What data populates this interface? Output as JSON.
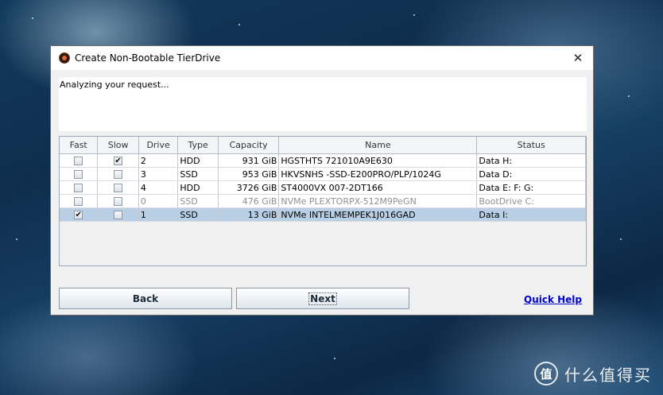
{
  "dialog": {
    "title": "Create Non-Bootable TierDrive",
    "close_glyph": "✕",
    "message": "Analyzing your request..."
  },
  "table": {
    "headers": [
      "Fast",
      "Slow",
      "Drive",
      "Type",
      "Capacity",
      "Name",
      "Status"
    ],
    "rows": [
      {
        "fast": false,
        "slow": true,
        "drive": "2",
        "type": "HDD",
        "capacity": "931 GiB",
        "name": "HGSTHTS 721010A9E630",
        "status": "Data H:",
        "disabled": false,
        "selected": false
      },
      {
        "fast": false,
        "slow": false,
        "drive": "3",
        "type": "SSD",
        "capacity": "953 GiB",
        "name": "HKVSNHS -SSD-E200PRO/PLP/1024G",
        "status": "Data D:",
        "disabled": false,
        "selected": false
      },
      {
        "fast": false,
        "slow": false,
        "drive": "4",
        "type": "HDD",
        "capacity": "3726 GiB",
        "name": "ST4000VX 007-2DT166",
        "status": "Data E: F: G:",
        "disabled": false,
        "selected": false
      },
      {
        "fast": false,
        "slow": false,
        "drive": "0",
        "type": "SSD",
        "capacity": "476 GiB",
        "name": "NVMe PLEXTORPX-512M9PeGN",
        "status": "BootDrive C:",
        "disabled": true,
        "selected": false
      },
      {
        "fast": true,
        "slow": false,
        "drive": "1",
        "type": "SSD",
        "capacity": "13 GiB",
        "name": "NVMe INTELMEMPEK1J016GAD",
        "status": "Data I:",
        "disabled": false,
        "selected": true
      }
    ]
  },
  "buttons": {
    "back": "Back",
    "next": "Next",
    "quick_help": "Quick Help"
  },
  "watermark": {
    "logo_glyph": "值",
    "text": "什么值得买"
  },
  "colors": {
    "selected_row": "#b8cfe5",
    "link": "#0000cc"
  }
}
